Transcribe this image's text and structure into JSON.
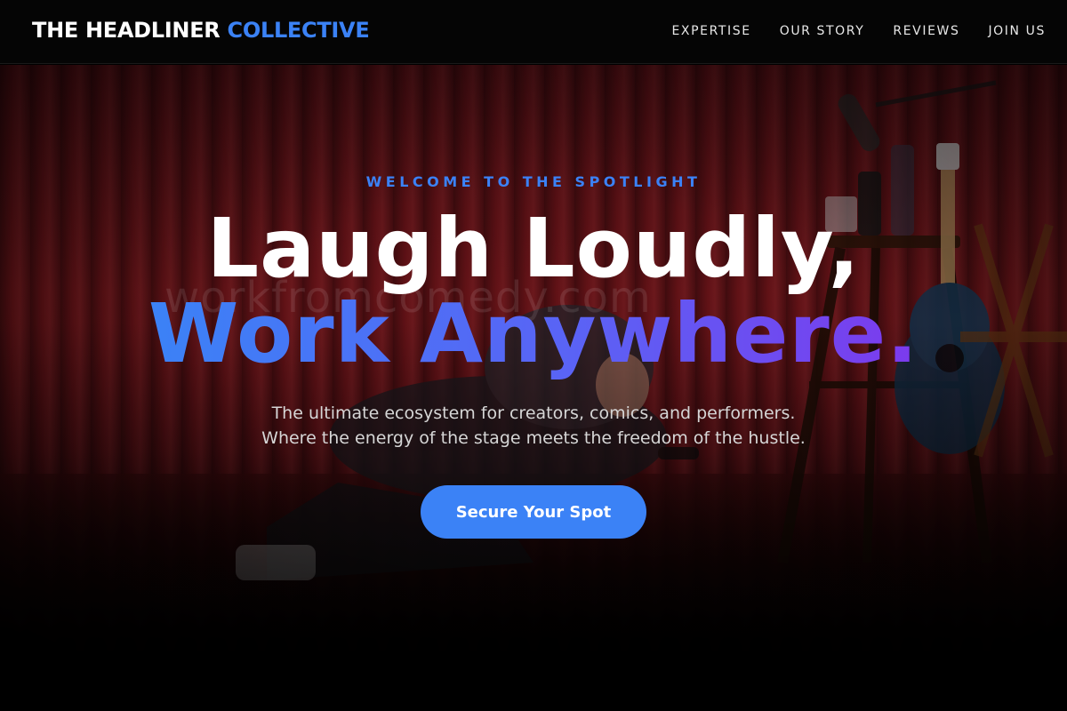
{
  "brand": {
    "name_primary": "THE HEADLINER",
    "name_accent": "COLLECTIVE",
    "accent_color": "#3b82f6"
  },
  "nav": {
    "links": [
      "EXPERTISE",
      "OUR STORY",
      "REVIEWS",
      "JOIN US"
    ]
  },
  "hero": {
    "eyebrow": "WELCOME TO THE SPOTLIGHT",
    "headline_line1": "Laugh Loudly,",
    "headline_line2": "Work Anywhere.",
    "subtitle_line1": "The ultimate ecosystem for creators, comics, and performers.",
    "subtitle_line2": "Where the energy of the stage meets the freedom of the hustle.",
    "cta_label": "Secure Your Spot",
    "background_watermark": "workfromcomedy.com",
    "gradient_colors": [
      "#3b82f6",
      "#7c3aed"
    ]
  }
}
